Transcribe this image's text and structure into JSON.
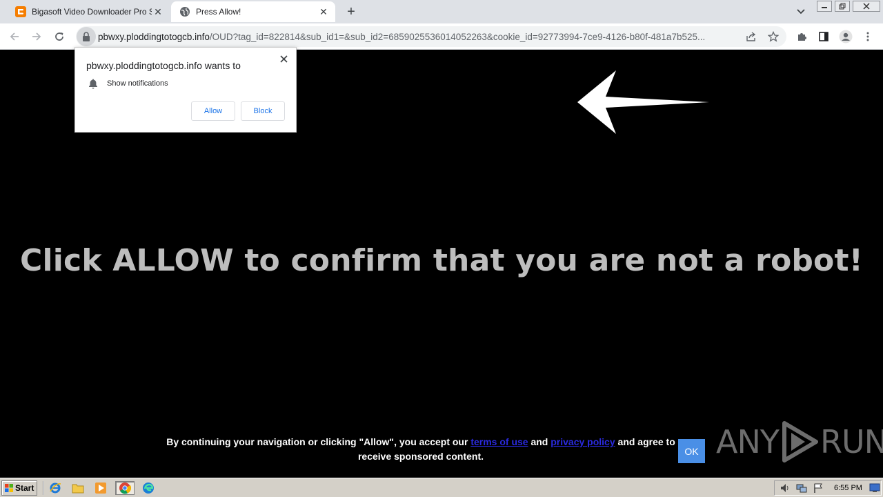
{
  "browser": {
    "tabs": [
      {
        "title": "Bigasoft Video Downloader Pro Serial",
        "favicon": "blogger-icon",
        "active": false
      },
      {
        "title": "Press Allow!",
        "favicon": "globe-icon",
        "active": true
      }
    ],
    "new_tab_label": "+",
    "address": {
      "host": "pbwxy.ploddingtotogcb.info",
      "path": "/OUD?tag_id=822814&sub_id1=&sub_id2=6859025536014052263&cookie_id=92773994-7ce9-4126-b80f-481a7b525..."
    },
    "accent_color": "#1a73e8"
  },
  "permission_popup": {
    "title": "pbwxy.ploddingtotogcb.info wants to",
    "permission": "Show notifications",
    "allow_label": "Allow",
    "block_label": "Block"
  },
  "page": {
    "headline": "Click ALLOW to confirm that you are not a robot!",
    "consent": {
      "text_before": "By continuing your navigation or clicking \"Allow\", you accept our",
      "terms_link": "terms of use",
      "and_text": "and",
      "privacy_link": "privacy policy",
      "text_after": "and agree to receive sponsored content."
    },
    "ok_label": "OK",
    "watermark": {
      "left": "ANY",
      "right": "RUN"
    }
  },
  "taskbar": {
    "start_label": "Start",
    "clock": "6:55 PM"
  }
}
